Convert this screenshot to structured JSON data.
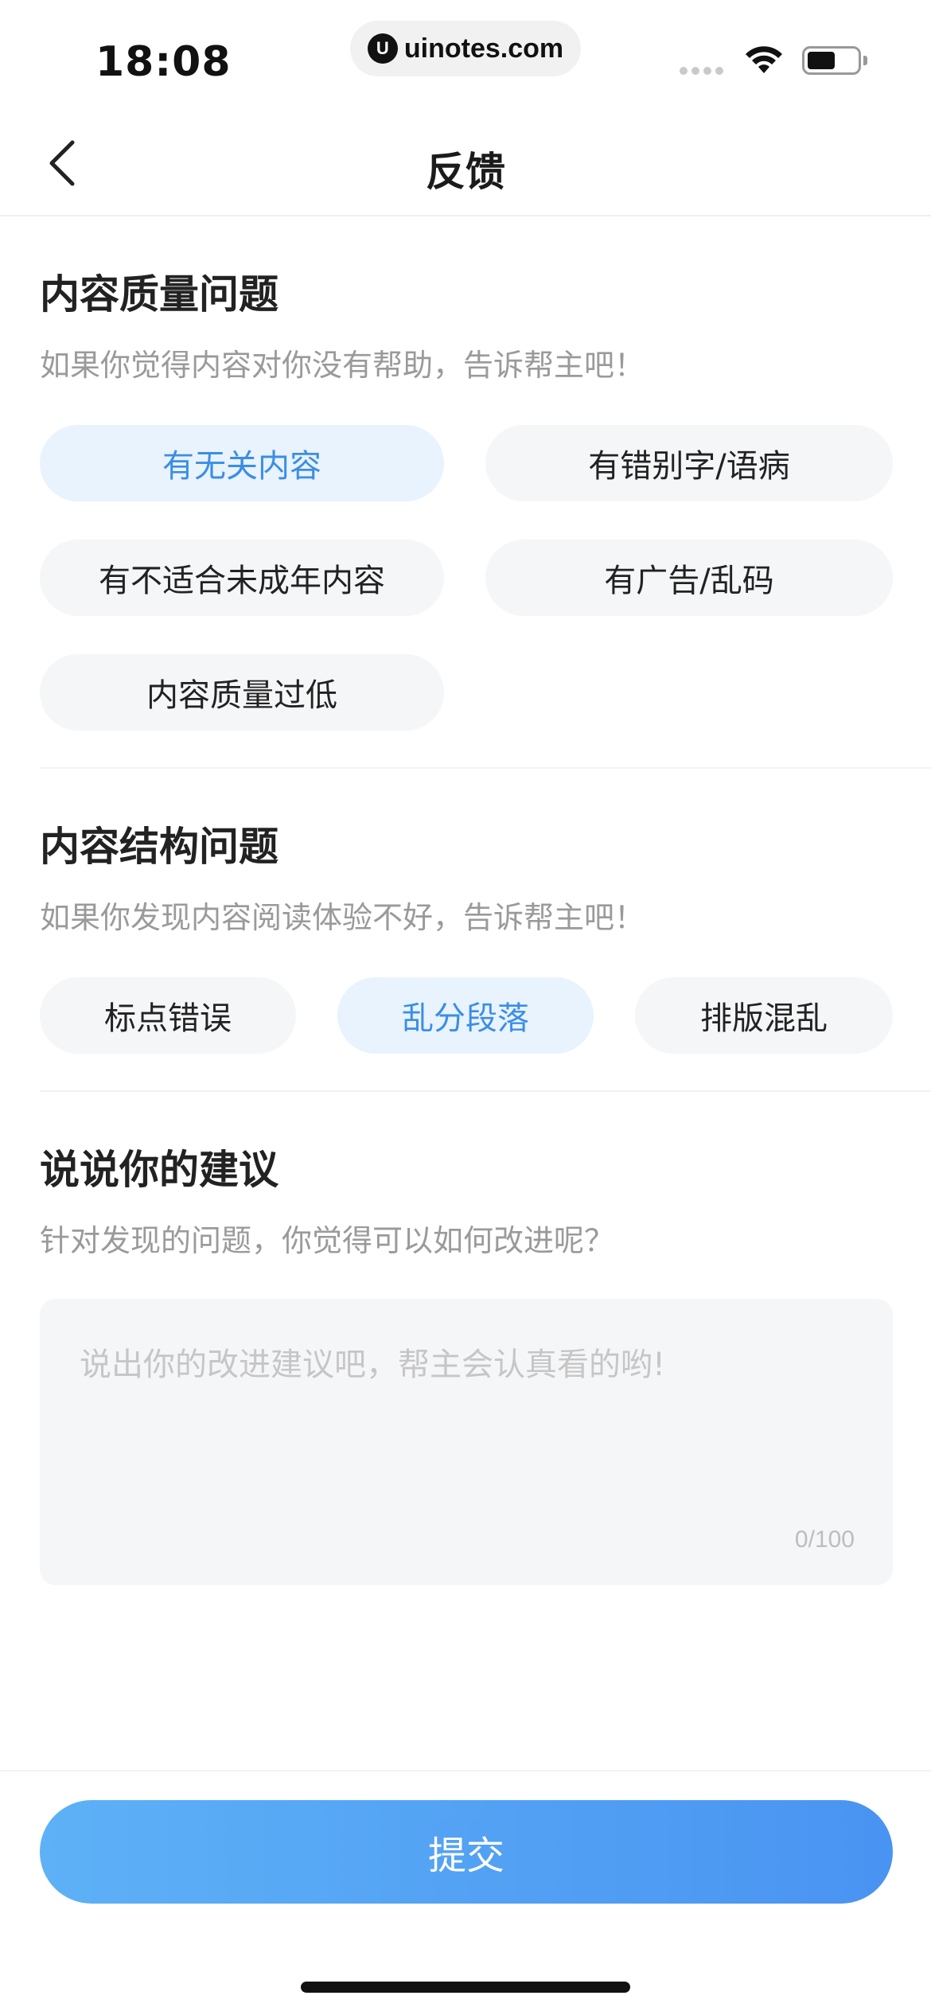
{
  "status_bar": {
    "time": "18:08",
    "url": "uinotes.com",
    "url_logo": "U"
  },
  "nav": {
    "title": "反馈",
    "back_icon": "chevron-left-icon"
  },
  "quality_section": {
    "title": "内容质量问题",
    "subtitle": "如果你觉得内容对你没有帮助，告诉帮主吧！",
    "options": [
      {
        "label": "有无关内容",
        "selected": true
      },
      {
        "label": "有错别字/语病",
        "selected": false
      },
      {
        "label": "有不适合未成年内容",
        "selected": false
      },
      {
        "label": "有广告/乱码",
        "selected": false
      },
      {
        "label": "内容质量过低",
        "selected": false
      }
    ]
  },
  "structure_section": {
    "title": "内容结构问题",
    "subtitle": "如果你发现内容阅读体验不好，告诉帮主吧！",
    "options": [
      {
        "label": "标点错误",
        "selected": false
      },
      {
        "label": "乱分段落",
        "selected": true
      },
      {
        "label": "排版混乱",
        "selected": false
      }
    ]
  },
  "suggestion_section": {
    "title": "说说你的建议",
    "subtitle": "针对发现的问题，你觉得可以如何改进呢？",
    "input_value": "",
    "placeholder": "说出你的改进建议吧，帮主会认真看的哟!",
    "counter": "0/100"
  },
  "submit": {
    "label": "提交"
  },
  "colors": {
    "accent": "#3a8ee6",
    "chip_bg": "#f5f6f8",
    "chip_selected_bg": "#e9f3fe",
    "button_gradient_start": "#55adf6",
    "button_gradient_end": "#3f8ef1"
  }
}
